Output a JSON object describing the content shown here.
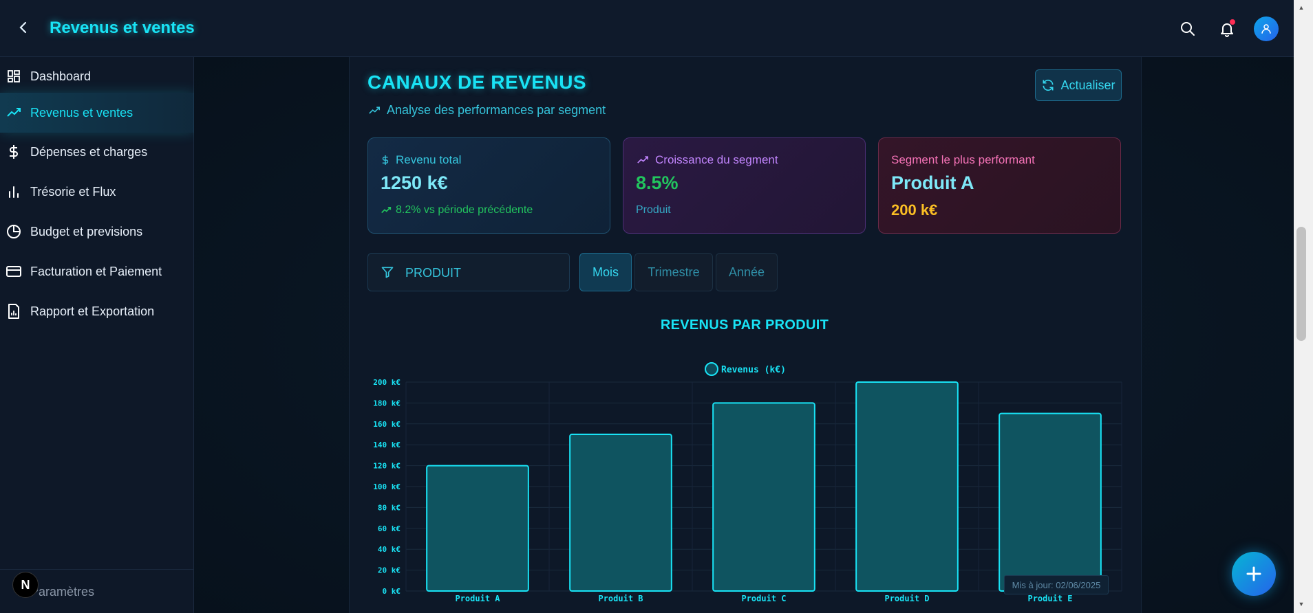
{
  "header": {
    "title": "Revenus et ventes"
  },
  "sidebar": {
    "items": [
      {
        "label": "Dashboard",
        "icon": "dashboard-icon"
      },
      {
        "label": "Revenus et ventes",
        "icon": "trending-up-icon",
        "active": true
      },
      {
        "label": "Dépenses et charges",
        "icon": "dollar-icon"
      },
      {
        "label": "Trésorie et Flux",
        "icon": "bar-chart-icon"
      },
      {
        "label": "Budget et previsions",
        "icon": "pie-chart-icon"
      },
      {
        "label": "Facturation et Paiement",
        "icon": "credit-card-icon"
      },
      {
        "label": "Rapport et Exportation",
        "icon": "report-icon"
      }
    ],
    "settings_label": "Paramètres",
    "badge_letter": "N"
  },
  "main": {
    "title": "CANAUX DE REVENUS",
    "subtitle": "Analyse des performances par segment",
    "refresh_label": "Actualiser",
    "cards": [
      {
        "label": "Revenu total",
        "value": "1250 k€",
        "foot": "8.2% vs période précédente"
      },
      {
        "label": "Croissance du segment",
        "value": "8.5%",
        "foot": "Produit"
      },
      {
        "label": "Segment le plus performant",
        "value": "Produit A",
        "foot": "200 k€"
      }
    ],
    "filter_label": "PRODUIT",
    "periods": [
      "Mois",
      "Trimestre",
      "Année"
    ],
    "active_period": "Mois",
    "updated_label": "Mis à jour: 02/06/2025"
  },
  "colors": {
    "accent": "#19e3f5",
    "green": "#22c55e",
    "purple": "#c084fc",
    "pink": "#f472b6",
    "gold": "#fbbf24"
  },
  "chart_data": {
    "type": "bar",
    "title": "REVENUS PAR PRODUIT",
    "categories": [
      "Produit A",
      "Produit B",
      "Produit C",
      "Produit D",
      "Produit E"
    ],
    "series": [
      {
        "name": "Revenus (k€)",
        "values": [
          120,
          150,
          180,
          200,
          170
        ]
      }
    ],
    "ylim": [
      0,
      200
    ],
    "yticks": [
      "0 k€",
      "20 k€",
      "40 k€",
      "60 k€",
      "80 k€",
      "100 k€",
      "120 k€",
      "140 k€",
      "160 k€",
      "180 k€",
      "200 k€"
    ],
    "legend": "top-center",
    "grid": true
  }
}
